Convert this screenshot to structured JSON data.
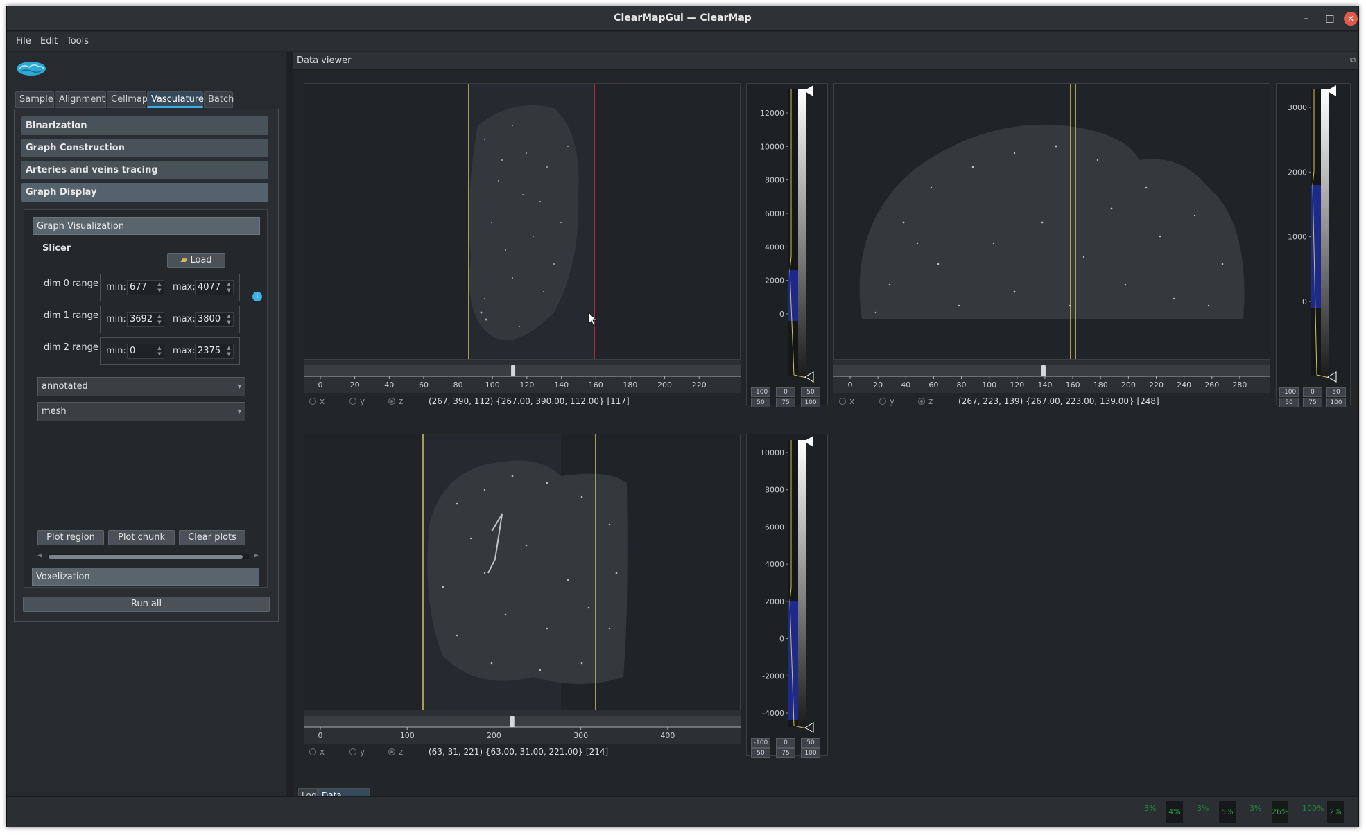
{
  "window": {
    "title": "ClearMapGui — ClearMap"
  },
  "menubar": [
    "File",
    "Edit",
    "Tools"
  ],
  "tabs": [
    "Sample",
    "Alignment",
    "Cellmap",
    "Vasculature",
    "Batch"
  ],
  "sections": [
    "Binarization",
    "Graph Construction",
    "Arteries and veins tracing",
    "Graph Display"
  ],
  "graph_visualization": {
    "header": "Graph Visualization",
    "slicer_label": "Slicer",
    "load_label": "Load",
    "ranges": [
      {
        "label": "dim 0 range",
        "min": "677",
        "max": "4077"
      },
      {
        "label": "dim 1 range",
        "min": "3692",
        "max": "3800"
      },
      {
        "label": "dim 2 range",
        "min": "0",
        "max": "2375"
      }
    ],
    "min_label": "min:",
    "max_label": "max:",
    "combo1": "annotated",
    "combo2": "mesh",
    "buttons": [
      "Plot region",
      "Plot chunk",
      "Clear plots"
    ],
    "voxelization": "Voxelization"
  },
  "run_all": "Run all",
  "data_viewer": {
    "title": "Data viewer",
    "viewers": [
      {
        "axis_ticks": [
          "0",
          "20",
          "40",
          "60",
          "80",
          "100",
          "120",
          "140",
          "160",
          "180",
          "200",
          "220"
        ],
        "slider_value": 112,
        "coords": "(267, 390, 112) {267.00, 390.00, 112.00} [117]",
        "hist_ticks": [
          "12000",
          "10000",
          "8000",
          "6000",
          "4000",
          "2000",
          "0"
        ]
      },
      {
        "axis_ticks": [
          "0",
          "20",
          "40",
          "60",
          "80",
          "100",
          "120",
          "140",
          "160",
          "180",
          "200",
          "220",
          "240",
          "260",
          "280"
        ],
        "slider_value": 139,
        "coords": "(267, 223, 139) {267.00, 223.00, 139.00} [248]",
        "hist_ticks": [
          "3000",
          "2000",
          "1000",
          "0"
        ]
      },
      {
        "axis_ticks": [
          "0",
          "100",
          "200",
          "300",
          "400"
        ],
        "slider_value": 221,
        "coords": "(63, 31, 221) {63.00, 31.00, 221.00} [214]",
        "hist_ticks": [
          "10000",
          "8000",
          "6000",
          "4000",
          "2000",
          "0",
          "-2000",
          "-4000"
        ]
      }
    ],
    "radio": [
      "x",
      "y",
      "z"
    ],
    "level_buttons": [
      [
        "-100",
        "0",
        "50"
      ],
      [
        "50",
        "75",
        "100"
      ]
    ]
  },
  "bottom_tabs": [
    "Log",
    "Data viewer"
  ],
  "status_meters": [
    {
      "label": "3%",
      "box": "4%"
    },
    {
      "label": "3%",
      "box": "5%"
    },
    {
      "label": "3%",
      "box": "26%"
    },
    {
      "label": "100%",
      "box": "2%"
    }
  ],
  "colors": {
    "accent": "#3daee9",
    "crosshair_yellow": "#cfc45a",
    "crosshair_red": "#d9323a",
    "histogram_fill": "#1d2a8c"
  }
}
